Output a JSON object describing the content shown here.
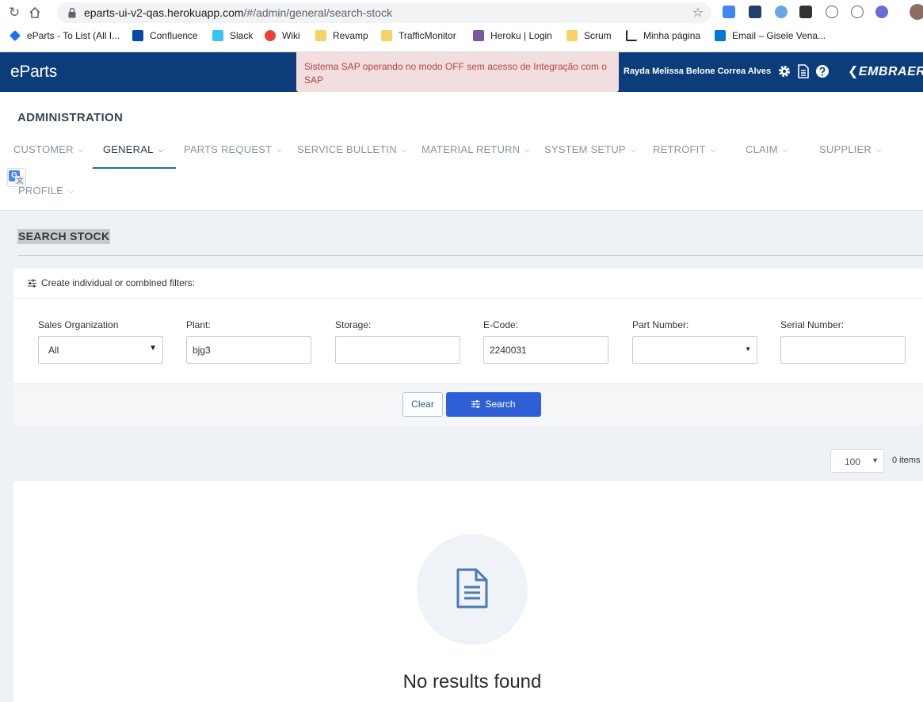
{
  "browser": {
    "url_host": "eparts-ui-v2-qas.herokuapp.com",
    "url_path": "/#/admin/general/search-stock",
    "bookmarks": [
      {
        "label": "eParts - To List (All I...",
        "color": "#1a73e8"
      },
      {
        "label": "Confluence",
        "color": "#0747a6"
      },
      {
        "label": "Slack",
        "color": "#36c5f0"
      },
      {
        "label": "Wiki",
        "color": "#ea4335"
      },
      {
        "label": "Revamp",
        "color": "#f6d365"
      },
      {
        "label": "TrafficMonitor",
        "color": "#f6d365"
      },
      {
        "label": "Heroku | Login",
        "color": "#79589f"
      },
      {
        "label": "Scrum",
        "color": "#f6d365"
      },
      {
        "label": "Minha página",
        "color": "#222222"
      },
      {
        "label": "Email – Gisele Vena...",
        "color": "#0078d4"
      }
    ]
  },
  "header": {
    "brand": "eParts",
    "sap_warning": "Sistema SAP operando no modo OFF sem acesso de Integração com o SAP",
    "user_name": "Rayda Melissa Belone Correa Alves",
    "logo_text": "EMBRAER",
    "bg_color": "#0a3d7a"
  },
  "admin": {
    "title": "ADMINISTRATION",
    "nav": [
      {
        "label": "CUSTOMER",
        "active": false
      },
      {
        "label": "GENERAL",
        "active": true
      },
      {
        "label": "PARTS REQUEST",
        "active": false
      },
      {
        "label": "SERVICE BULLETIN",
        "active": false
      },
      {
        "label": "MATERIAL RETURN",
        "active": false
      },
      {
        "label": "SYSTEM SETUP",
        "active": false
      },
      {
        "label": "RETROFIT",
        "active": false
      },
      {
        "label": "CLAIM",
        "active": false
      },
      {
        "label": "SUPPLIER",
        "active": false
      },
      {
        "label": "PROFILE",
        "active": false
      }
    ]
  },
  "page": {
    "title": "SEARCH STOCK",
    "filter_hint": "Create individual or combined filters:",
    "fields": [
      {
        "label": "Sales Organization",
        "value": "All",
        "type": "select"
      },
      {
        "label": "Plant:",
        "value": "bjg3",
        "type": "text"
      },
      {
        "label": "Storage:",
        "value": "",
        "type": "text"
      },
      {
        "label": "E-Code:",
        "value": "2240031",
        "type": "text"
      },
      {
        "label": "Part Number:",
        "value": "",
        "type": "select"
      },
      {
        "label": "Serial Number:",
        "value": "",
        "type": "text"
      }
    ],
    "clear_label": "Clear",
    "search_label": "Search",
    "page_size": "100",
    "item_count": "0 items",
    "empty_message": "No results found",
    "accent_color": "#2f5fd6"
  }
}
